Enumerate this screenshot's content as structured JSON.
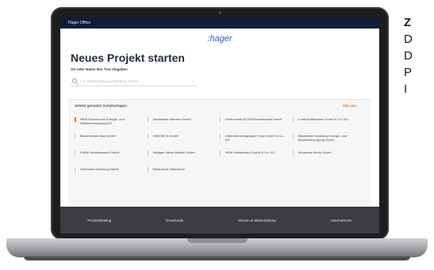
{
  "app": {
    "topbar_title": "Hager Office",
    "logo": ":hager"
  },
  "page": {
    "title": "Neues Projekt starten",
    "field_label": "Ort oder Name des TGA eingeben",
    "search_placeholder": "z.B. Elektroplanung Hamburg GmbH"
  },
  "recent": {
    "title": "Zuletzt genutzte Schaltanlagen",
    "view_all": "Alle anz.",
    "items": [
      {
        "label": "HEW Kommunale Energie- und Wasserversorgung AG",
        "highlight": true
      },
      {
        "label": "Stadtwerke Münster GmbH",
        "highlight": false
      },
      {
        "label": "Rheinmetall ACTIENGesellschaft GmbH",
        "highlight": false
      },
      {
        "label": "s.mild Bufflhausen GmbH & Co. KG",
        "highlight": false
      },
      {
        "label": "Bauermeister Bau GmbH",
        "highlight": false
      },
      {
        "label": "GNN BB G GmbH",
        "highlight": false
      },
      {
        "label": "Unternehmensgruppe Fritze GmbH & Co. KG",
        "highlight": false
      },
      {
        "label": "Stadtwerke Hamburg Energie- und Wasserversorgung GmbH",
        "highlight": false
      },
      {
        "label": "EnBW Westfernwerk GmbH",
        "highlight": false
      },
      {
        "label": "Stuttgart Netze Betrieb GmbH",
        "highlight": false
      },
      {
        "label": "HEW Infrastruktur GmbH & Co. KG",
        "highlight": false
      },
      {
        "label": "Stromnetz Berlin GmbH",
        "highlight": false
      },
      {
        "label": "Stromnetz Hamburg GmbH",
        "highlight": false
      },
      {
        "label": "Elektrische Stahlwerke",
        "highlight": false
      }
    ]
  },
  "footer": {
    "links": [
      "Produktkatalog",
      "Downloads",
      "Wissen & Weiterbildung",
      "Unternehmen"
    ]
  },
  "side_text": {
    "heading": "Z",
    "lines": [
      "D",
      "D",
      "P",
      "I"
    ]
  },
  "colors": {
    "topbar": "#0f1c3a",
    "brand_blue": "#2864b4",
    "accent_orange": "#e8740f",
    "footer": "#3b3d41"
  }
}
